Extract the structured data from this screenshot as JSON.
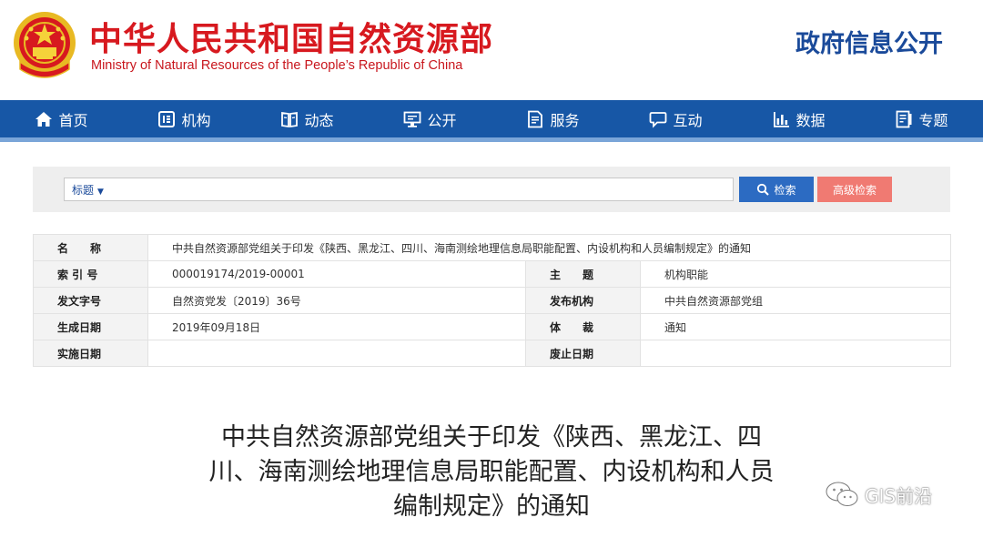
{
  "header": {
    "title_cn": "中华人民共和国自然资源部",
    "title_en": "Ministry of Natural Resources of the People’s Republic of China",
    "gov_open": "政府信息公开",
    "brand_red": "#d7191f",
    "brand_blue": "#1757a6"
  },
  "nav": {
    "items": [
      {
        "label": "首页",
        "icon": "home-icon"
      },
      {
        "label": "机构",
        "icon": "org-icon"
      },
      {
        "label": "动态",
        "icon": "book-icon"
      },
      {
        "label": "公开",
        "icon": "monitor-icon"
      },
      {
        "label": "服务",
        "icon": "document-icon"
      },
      {
        "label": "互动",
        "icon": "chat-icon"
      },
      {
        "label": "数据",
        "icon": "chart-icon"
      },
      {
        "label": "专题",
        "icon": "topic-icon"
      }
    ]
  },
  "search": {
    "scope": "标题",
    "value": "",
    "search_label": "检索",
    "advanced_label": "高级检索"
  },
  "info": {
    "name_label": "名　　称",
    "name_value": "中共自然资源部党组关于印发《陕西、黑龙江、四川、海南测绘地理信息局职能配置、内设机构和人员编制规定》的通知",
    "index_label": "索 引 号",
    "index_value": "000019174/2019-00001",
    "subject_label": "主　　题",
    "subject_value": "机构职能",
    "docno_label": "发文字号",
    "docno_value": "自然资党发〔2019〕36号",
    "issuer_label": "发布机构",
    "issuer_value": "中共自然资源部党组",
    "date_label": "生成日期",
    "date_value": "2019年09月18日",
    "genre_label": "体　　裁",
    "genre_value": "通知",
    "effective_label": "实施日期",
    "effective_value": "",
    "expiry_label": "废止日期",
    "expiry_value": ""
  },
  "document": {
    "title_line1": "中共自然资源部党组关于印发《陕西、黑龙江、四",
    "title_line2": "川、海南测绘地理信息局职能配置、内设机构和人员",
    "title_line3": "编制规定》的通知"
  },
  "watermark": {
    "text": "GIS前沿"
  }
}
